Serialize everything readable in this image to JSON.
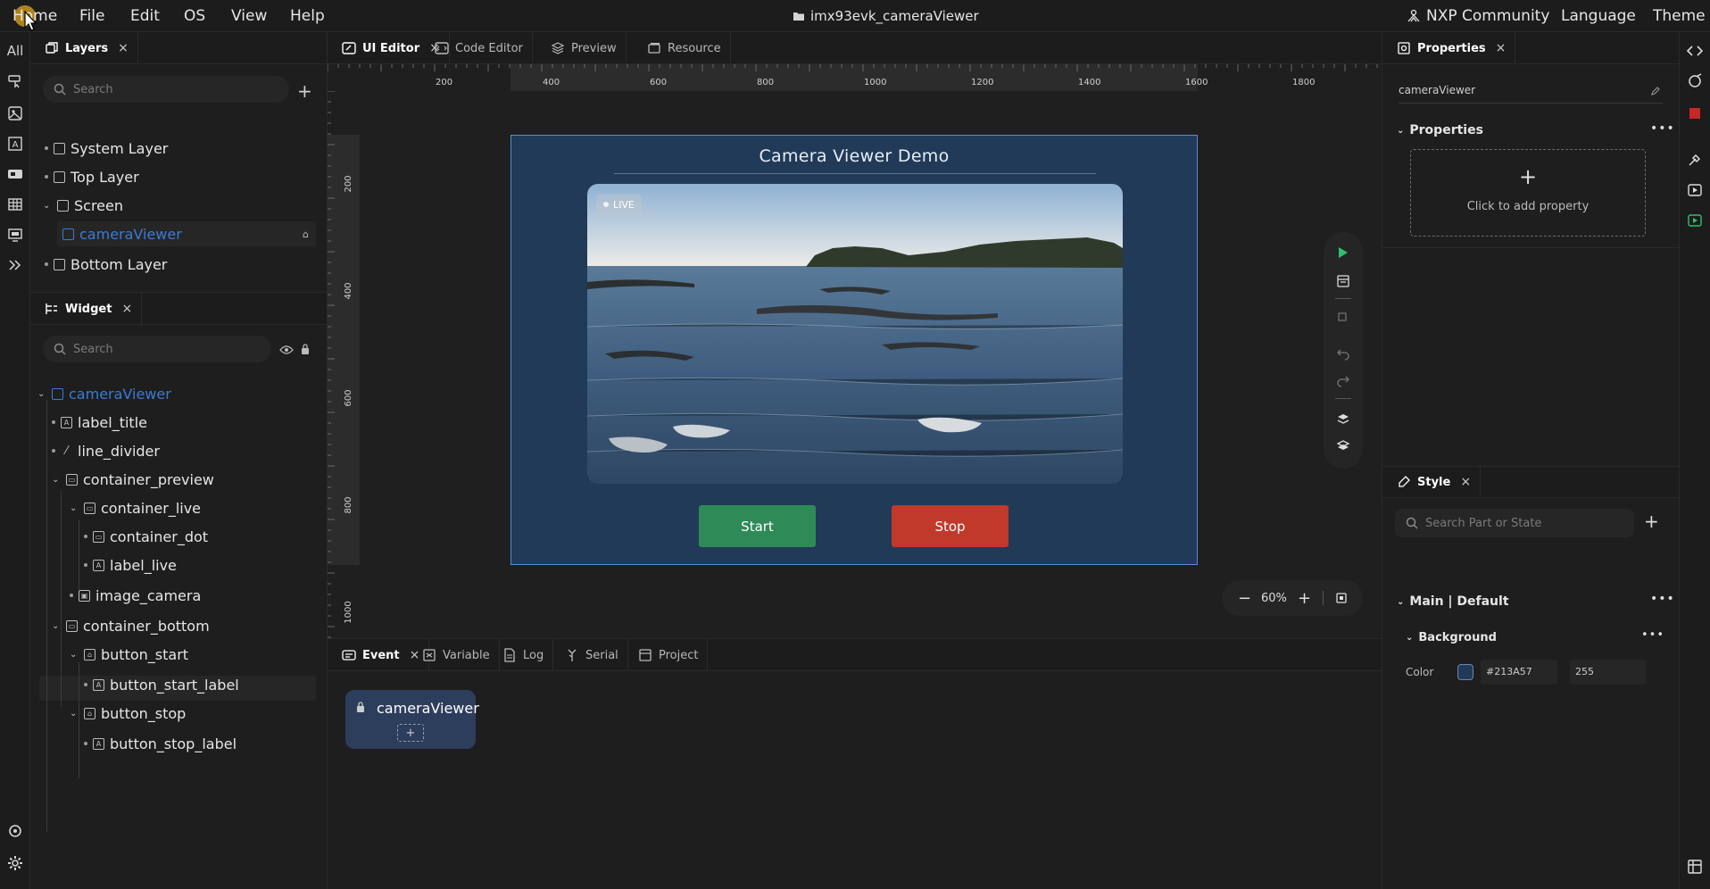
{
  "menubar": {
    "items": [
      "Home",
      "File",
      "Edit",
      "OS",
      "View",
      "Help"
    ],
    "project_title": "imx93evk_cameraViewer",
    "right_items": [
      "NXP Community",
      "Language",
      "Theme"
    ]
  },
  "left_rail": {
    "all_label": "All"
  },
  "layers_panel": {
    "tab_label": "Layers",
    "search_placeholder": "Search",
    "items": [
      {
        "label": "System Layer"
      },
      {
        "label": "Top Layer"
      },
      {
        "label": "Screen"
      },
      {
        "label": "cameraViewer"
      },
      {
        "label": "Bottom Layer"
      }
    ]
  },
  "widget_panel": {
    "tab_label": "Widget",
    "search_placeholder": "Search",
    "items": [
      {
        "label": "cameraViewer"
      },
      {
        "label": "label_title"
      },
      {
        "label": "line_divider"
      },
      {
        "label": "container_preview"
      },
      {
        "label": "container_live"
      },
      {
        "label": "container_dot"
      },
      {
        "label": "label_live"
      },
      {
        "label": "image_camera"
      },
      {
        "label": "container_bottom"
      },
      {
        "label": "button_start"
      },
      {
        "label": "button_start_label"
      },
      {
        "label": "button_stop"
      },
      {
        "label": "button_stop_label"
      }
    ]
  },
  "editor_tabs": [
    "UI Editor",
    "Code Editor",
    "Preview",
    "Resource"
  ],
  "ruler": {
    "top_ticks": [
      "200",
      "400",
      "600",
      "800",
      "1000",
      "1200",
      "1400",
      "1600",
      "1800"
    ],
    "left_ticks": [
      "200",
      "400",
      "600",
      "800",
      "1000"
    ]
  },
  "screen": {
    "title": "Camera Viewer Demo",
    "live_label": "LIVE",
    "start_label": "Start",
    "stop_label": "Stop"
  },
  "zoom": {
    "level": "60%"
  },
  "bottom_tabs": [
    "Event",
    "Variable",
    "Log",
    "Serial",
    "Project"
  ],
  "event_card": {
    "label": "cameraViewer",
    "add": "+"
  },
  "properties_panel": {
    "tab_label": "Properties",
    "object_name": "cameraViewer",
    "section_label": "Properties",
    "add_symbol": "+",
    "add_hint": "Click to add property"
  },
  "style_panel": {
    "tab_label": "Style",
    "search_placeholder": "Search Part or State",
    "section_label": "Main | Default",
    "subsection_label": "Background",
    "color_label": "Color",
    "color_hex": "#213A57",
    "opacity": "255"
  },
  "colors": {
    "screen_bg": "#213A57",
    "accent_blue": "#3a7bd5",
    "start_green": "#2e8b57",
    "stop_red": "#c0392b",
    "run_green": "#2fbf71"
  }
}
